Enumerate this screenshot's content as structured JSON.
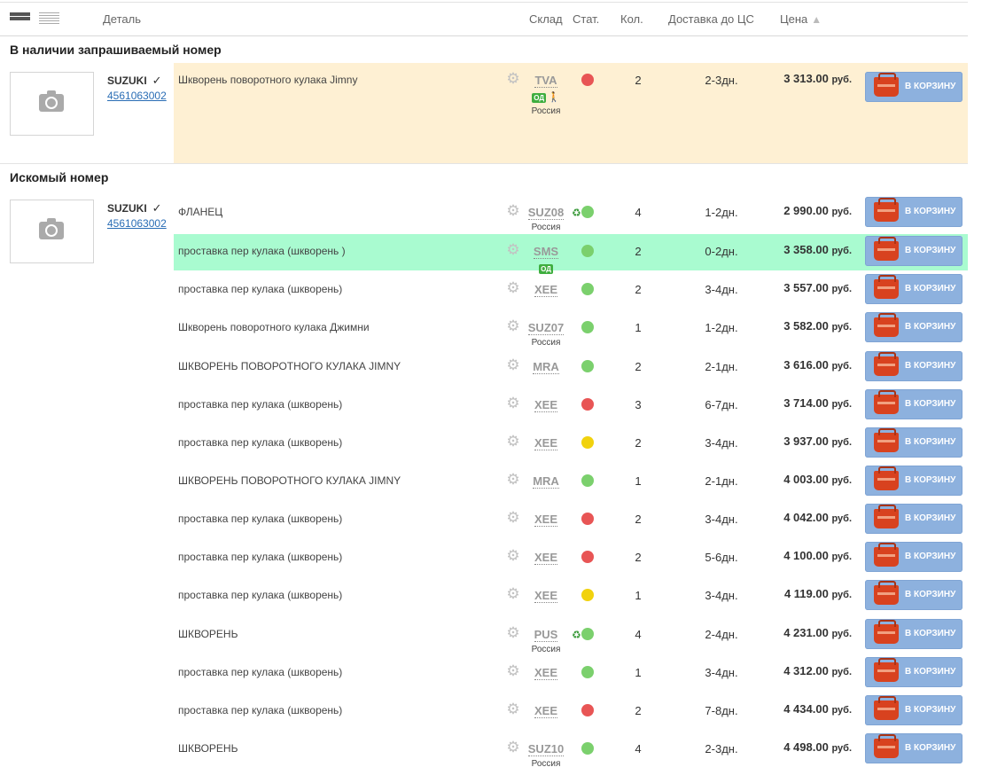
{
  "header": {
    "detail": "Деталь",
    "warehouse": "Склад",
    "status": "Стат.",
    "qty": "Кол.",
    "delivery": "Доставка до ЦС",
    "price": "Цена",
    "sort_icon": "arrow-up-icon"
  },
  "sections": {
    "requested": "В наличии запрашиваемый номер",
    "searched": "Искомый номер"
  },
  "part": {
    "brand": "SUZUKI",
    "number": "4561063002",
    "check_icon": "checkmark-icon"
  },
  "cart_label": "В КОРЗИНУ",
  "status_colors": {
    "red": "#e85555",
    "green": "#7bd06d",
    "yellow": "#f1d20e"
  },
  "requested_row": {
    "desc": "Шкворень поворотного кулака Jimny",
    "wh": "TVA",
    "od": "ОД",
    "country": "Россия",
    "status": "red",
    "qty": "2",
    "delivery": "2-3дн.",
    "price": "3 313.00",
    "cur": "руб."
  },
  "rows": [
    {
      "desc": "ФЛАНЕЦ",
      "wh": "SUZ08",
      "country": "Россия",
      "recycle": true,
      "status": "green",
      "qty": "4",
      "delivery": "1-2дн.",
      "price": "2 990.00",
      "cur": "руб."
    },
    {
      "desc": "проставка пер кулака (шкворень )",
      "wh": "SMS",
      "od": "ОД",
      "status": "green",
      "qty": "2",
      "delivery": "0-2дн.",
      "price": "3 358.00",
      "cur": "руб.",
      "highlight": true
    },
    {
      "desc": "проставка пер кулака (шкворень)",
      "wh": "XEE",
      "status": "green",
      "qty": "2",
      "delivery": "3-4дн.",
      "price": "3 557.00",
      "cur": "руб."
    },
    {
      "desc": "Шкворень поворотного кулака Джимни",
      "wh": "SUZ07",
      "country": "Россия",
      "status": "green",
      "qty": "1",
      "delivery": "1-2дн.",
      "price": "3 582.00",
      "cur": "руб."
    },
    {
      "desc": "ШКВОРЕНЬ ПОВОРОТНОГО КУЛАКА JIMNY",
      "wh": "MRA",
      "status": "green",
      "qty": "2",
      "delivery": "2-1дн.",
      "price": "3 616.00",
      "cur": "руб."
    },
    {
      "desc": "проставка пер кулака (шкворень)",
      "wh": "XEE",
      "status": "red",
      "qty": "3",
      "delivery": "6-7дн.",
      "price": "3 714.00",
      "cur": "руб."
    },
    {
      "desc": "проставка пер кулака (шкворень)",
      "wh": "XEE",
      "status": "yellow",
      "qty": "2",
      "delivery": "3-4дн.",
      "price": "3 937.00",
      "cur": "руб."
    },
    {
      "desc": "ШКВОРЕНЬ ПОВОРОТНОГО КУЛАКА JIMNY",
      "wh": "MRA",
      "status": "green",
      "qty": "1",
      "delivery": "2-1дн.",
      "price": "4 003.00",
      "cur": "руб."
    },
    {
      "desc": "проставка пер кулака (шкворень)",
      "wh": "XEE",
      "status": "red",
      "qty": "2",
      "delivery": "3-4дн.",
      "price": "4 042.00",
      "cur": "руб."
    },
    {
      "desc": "проставка пер кулака (шкворень)",
      "wh": "XEE",
      "status": "red",
      "qty": "2",
      "delivery": "5-6дн.",
      "price": "4 100.00",
      "cur": "руб."
    },
    {
      "desc": "проставка пер кулака (шкворень)",
      "wh": "XEE",
      "status": "yellow",
      "qty": "1",
      "delivery": "3-4дн.",
      "price": "4 119.00",
      "cur": "руб."
    },
    {
      "desc": "ШКВОРЕНЬ",
      "wh": "PUS",
      "country": "Россия",
      "recycle": true,
      "status": "green",
      "qty": "4",
      "delivery": "2-4дн.",
      "price": "4 231.00",
      "cur": "руб."
    },
    {
      "desc": "проставка пер кулака (шкворень)",
      "wh": "XEE",
      "status": "green",
      "qty": "1",
      "delivery": "3-4дн.",
      "price": "4 312.00",
      "cur": "руб."
    },
    {
      "desc": "проставка пер кулака (шкворень)",
      "wh": "XEE",
      "status": "red",
      "qty": "2",
      "delivery": "7-8дн.",
      "price": "4 434.00",
      "cur": "руб."
    },
    {
      "desc": "ШКВОРЕНЬ",
      "wh": "SUZ10",
      "country": "Россия",
      "status": "green",
      "qty": "4",
      "delivery": "2-3дн.",
      "price": "4 498.00",
      "cur": "руб."
    }
  ]
}
